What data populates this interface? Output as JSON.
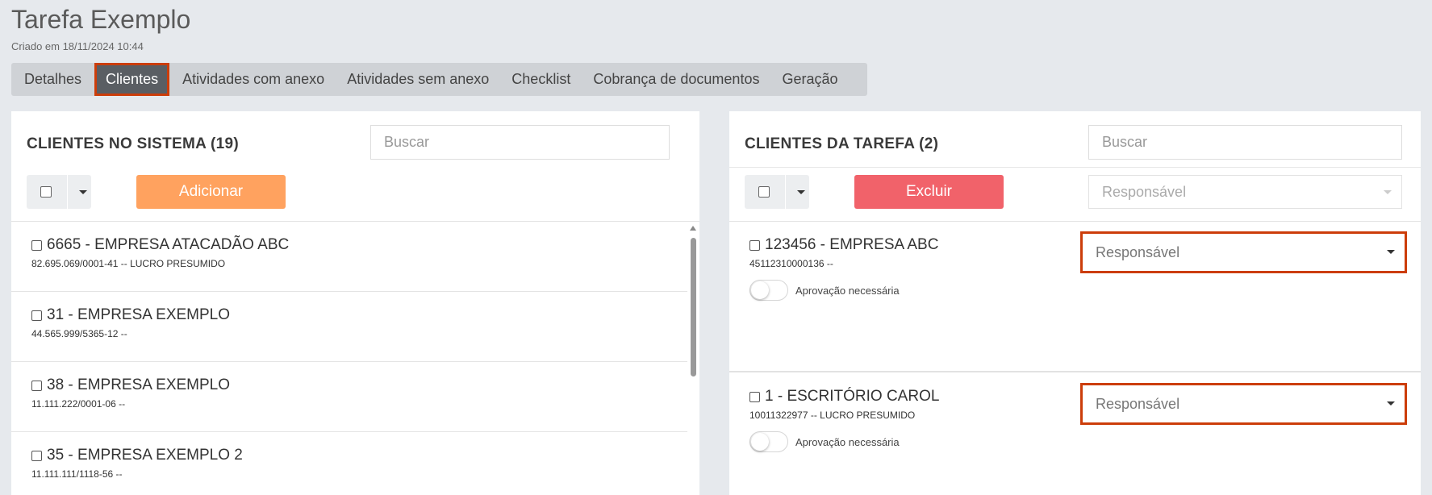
{
  "page": {
    "title": "Tarefa Exemplo",
    "subtitle": "Criado em 18/11/2024 10:44"
  },
  "tabs": [
    {
      "label": "Detalhes",
      "active": false
    },
    {
      "label": "Clientes",
      "active": true
    },
    {
      "label": "Atividades com anexo",
      "active": false
    },
    {
      "label": "Atividades sem anexo",
      "active": false
    },
    {
      "label": "Checklist",
      "active": false
    },
    {
      "label": "Cobrança de documentos",
      "active": false
    },
    {
      "label": "Geração",
      "active": false
    }
  ],
  "left_panel": {
    "title": "CLIENTES NO SISTEMA (19)",
    "search_placeholder": "Buscar",
    "add_label": "Adicionar",
    "items": [
      {
        "title": "6665 - EMPRESA ATACADÃO ABC",
        "sub": "82.695.069/0001-41 -- LUCRO PRESUMIDO"
      },
      {
        "title": "31 - EMPRESA EXEMPLO",
        "sub": "44.565.999/5365-12 --"
      },
      {
        "title": "38 - EMPRESA EXEMPLO",
        "sub": "11.111.222/0001-06 --"
      },
      {
        "title": "35 - EMPRESA EXEMPLO 2",
        "sub": "11.111.111/1118-56 --"
      }
    ]
  },
  "right_panel": {
    "title": "CLIENTES DA TAREFA (2)",
    "search_placeholder": "Buscar",
    "delete_label": "Excluir",
    "responsavel_placeholder": "Responsável",
    "items": [
      {
        "title": "123456 - EMPRESA ABC",
        "sub": "45112310000136 --",
        "toggle_label": "Aprovação necessária",
        "responsavel": "Responsável"
      },
      {
        "title": "1 - ESCRITÓRIO CAROL",
        "sub": "10011322977 -- LUCRO PRESUMIDO",
        "toggle_label": "Aprovação necessária",
        "responsavel": "Responsável"
      }
    ]
  },
  "colors": {
    "accent_highlight": "#cc3d0a",
    "add_button": "#ffa25f",
    "delete_button": "#f1626a",
    "active_tab": "#5a5e63"
  }
}
